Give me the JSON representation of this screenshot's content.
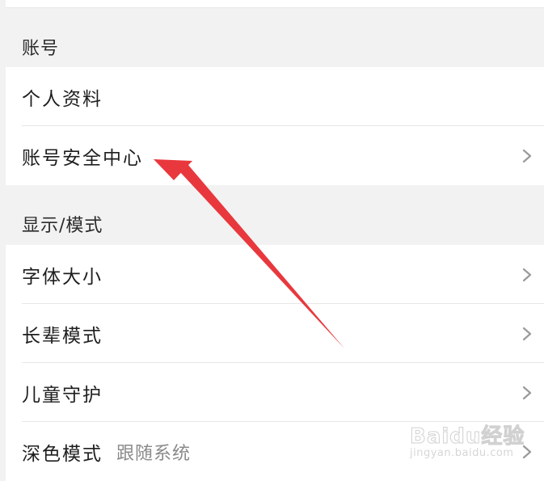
{
  "sections": [
    {
      "header": "账号",
      "items": [
        {
          "label": "个人资料"
        },
        {
          "label": "账号安全中心"
        }
      ]
    },
    {
      "header": "显示/模式",
      "items": [
        {
          "label": "字体大小"
        },
        {
          "label": "长辈模式"
        },
        {
          "label": "儿童守护"
        },
        {
          "label": "深色模式",
          "value": "跟随系统"
        }
      ]
    }
  ],
  "watermark": {
    "main": "Baidu经验",
    "sub": "jingyan.baidu.com"
  },
  "annotation": {
    "color": "#e8383d",
    "points_to": "账号安全中心"
  },
  "icons": {
    "chevron": "chevron-right-icon",
    "arrow": "red-annotation-arrow"
  }
}
